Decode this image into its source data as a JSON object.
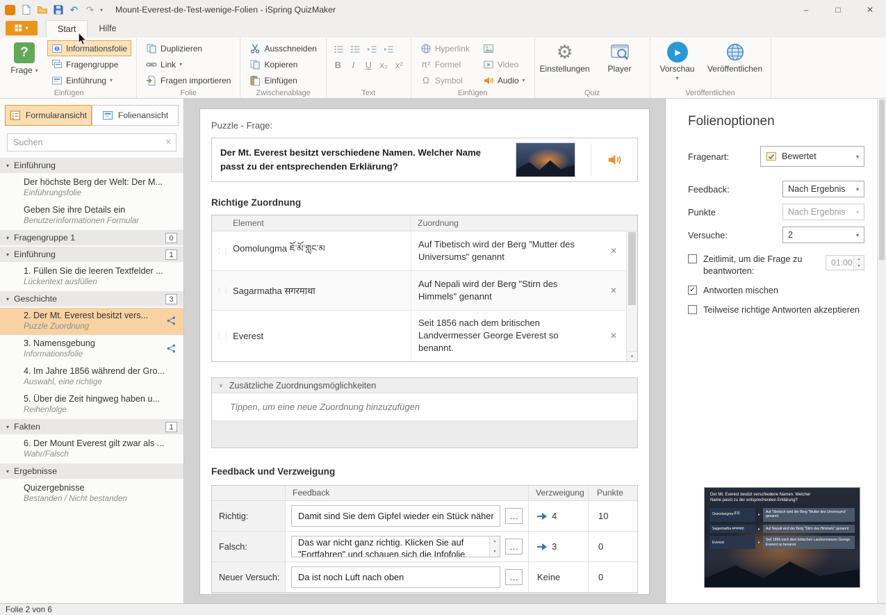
{
  "titlebar": {
    "title": "Mount-Everest-de-Test-wenige-Folien - iSpring QuizMaker"
  },
  "tabs": {
    "start": "Start",
    "hilfe": "Hilfe"
  },
  "icons": {
    "caret": "▾",
    "chevron_down": "▾",
    "vee": "∨",
    "close": "✕",
    "clear": "✕",
    "minimize": "–",
    "maximize": "□",
    "undo": "↶",
    "redo": "↷",
    "gear": "⚙",
    "play": "▶",
    "more": "…",
    "drag": "⋮⋮",
    "check": "✓",
    "spin_up": "▲",
    "spin_down": "▼",
    "question": "?",
    "formula": "π²",
    "omega": "Ω",
    "tri_right": "▸"
  },
  "ribbon": {
    "frage": {
      "label": "Frage"
    },
    "insert_group": {
      "label": "Einfügen",
      "informationsfolie": "Informationsfolie",
      "fragengruppe": "Fragengruppe",
      "einfuehrung": "Einführung"
    },
    "folie_group": {
      "label": "Folie",
      "duplizieren": "Duplizieren",
      "link": "Link",
      "fragen_importieren": "Fragen importieren"
    },
    "clipboard_group": {
      "label": "Zwischenablage",
      "ausschneiden": "Ausschneiden",
      "kopieren": "Kopieren",
      "einfuegen": "Einfügen"
    },
    "text_group": {
      "label": "Text",
      "bold": "B",
      "italic": "I",
      "underline": "U",
      "subscript": "x₂",
      "superscript": "x²"
    },
    "insert2_group": {
      "label": "Einfügen",
      "hyperlink": "Hyperlink",
      "formel": "Formel",
      "symbol": "Symbol",
      "bild": "Bild",
      "video": "Video",
      "audio": "Audio"
    },
    "quiz_group": {
      "label": "Quiz",
      "einstellungen": "Einstellungen",
      "player": "Player"
    },
    "publish_group": {
      "label": "Veröffentlichen",
      "vorschau": "Vorschau",
      "veroeffentlichen": "Veröffentlichen"
    }
  },
  "sidebar": {
    "tabs": {
      "form": "Formularansicht",
      "slide": "Folienansicht"
    },
    "search_placeholder": "Suchen",
    "tree": [
      {
        "is_section": true,
        "label": "Einführung"
      },
      {
        "is_slide": true,
        "title": "Der höchste Berg der Welt: Der M...",
        "subtitle": "Einführungsfolie"
      },
      {
        "is_slide": true,
        "title": "Geben Sie ihre Details ein",
        "subtitle": "Benutzerinformationen Formular"
      },
      {
        "is_section": true,
        "label": "Fragengruppe 1",
        "badge": "0"
      },
      {
        "is_section": true,
        "label": "Einführung",
        "badge": "1"
      },
      {
        "is_slide": true,
        "title": "1. Füllen Sie die leeren Textfelder ...",
        "subtitle": "Lückentext ausfüllen"
      },
      {
        "is_section": true,
        "label": "Geschichte",
        "badge": "3"
      },
      {
        "is_slide": true,
        "title": "2. Der Mt. Everest besitzt vers...",
        "subtitle": "Puzzle Zuordnung",
        "selected": true,
        "branch": true
      },
      {
        "is_slide": true,
        "title": "3. Namensgebung",
        "subtitle": "Informationsfolie",
        "branch": true
      },
      {
        "is_slide": true,
        "title": "4. Im Jahre 1856 während der Gro...",
        "subtitle": "Auswahl, eine richtige"
      },
      {
        "is_slide": true,
        "title": "5. Über die Zeit hingweg haben u...",
        "subtitle": "Reihenfolge"
      },
      {
        "is_section": true,
        "label": "Fakten",
        "badge": "1"
      },
      {
        "is_slide": true,
        "title": "6. Der Mount Everest gilt zwar als ...",
        "subtitle": "Wahr/Falsch"
      },
      {
        "is_section": true,
        "label": "Ergebnisse"
      },
      {
        "is_slide": true,
        "title": "Quizergebnisse",
        "subtitle": "Bestanden / Nicht bestanden"
      }
    ]
  },
  "main": {
    "question_label": "Puzzle - Frage:",
    "question_text": "Der Mt. Everest besitzt verschiedene Namen. Welcher Name passt zu der entsprechenden Erklärung?",
    "matching": {
      "heading": "Richtige Zuordnung",
      "col_element": "Element",
      "col_zuordnung": "Zuordnung",
      "rows": [
        {
          "element": "Oomolungma ཇོ་མོ་གླང་མ",
          "match": "Auf Tibetisch wird der Berg \"Mutter des Universums\" genannt"
        },
        {
          "element": "Sagarmatha सगरमाथा",
          "match": "Auf Nepali wird der Berg \"Stirn des Himmels\" genannt"
        },
        {
          "element": "Everest",
          "match": "Seit 1856 nach dem britischen Landvermesser George Everest so benannt."
        }
      ]
    },
    "extra": {
      "heading": "Zusätzliche Zuordnungsmöglichkeiten",
      "hint": "Tippen, um eine neue Zuordnung hinzuzufügen"
    },
    "feedback": {
      "heading": "Feedback und Verzweigung",
      "col_feedback": "Feedback",
      "col_verzweigung": "Verzweigung",
      "col_punkte": "Punkte",
      "rows": [
        {
          "label": "Richtig:",
          "text": "Damit sind Sie dem Gipfel wieder ein Stück näher",
          "branch": "4",
          "points": "10",
          "has_arrow": true
        },
        {
          "label": "Falsch:",
          "text": "Das war nicht  ganz richtig. Klicken Sie auf \"Fortfahren\" und schauen sich die Infofolie genau",
          "branch": "3",
          "points": "0",
          "has_arrow": true,
          "spinner": true,
          "multiline": true
        },
        {
          "label": "Neuer Versuch:",
          "text": "Da ist noch Luft nach oben",
          "branch": "Keine",
          "points": "0"
        }
      ]
    }
  },
  "options": {
    "title": "Folienoptionen",
    "fragenart": {
      "label": "Fragenart:",
      "value": "Bewertet"
    },
    "feedback": {
      "label": "Feedback:",
      "value": "Nach Ergebnis"
    },
    "punkte": {
      "label": "Punkte",
      "value": "Nach Ergebnis"
    },
    "versuche": {
      "label": "Versuche:",
      "value": "2"
    },
    "zeitlimit": {
      "label": "Zeitlimit, um die Frage zu beantworten:",
      "value": "01:00"
    },
    "mischen": "Antworten mischen",
    "teilweise": "Teilweise richtige Antworten akzeptieren",
    "thumbnail": {
      "title": "Der Mt. Everest besitzt verschiedene Namen. Welcher Name passt zu der entsprechenden Erklärung?",
      "pairs": [
        {
          "left": "Oomolungma ཇོ་མོ་",
          "right": "Auf Tibetisch wird der Berg \"Mutter des Universums\" genannt"
        },
        {
          "left": "Sagarmatha सगरमाथा",
          "right": "Auf Nepali wird der Berg \"Stirn des Himmels\" genannt"
        },
        {
          "left": "Everest",
          "right": "Seit 1856 nach dem britischen Landvermesser George Everest so benannt"
        }
      ]
    }
  },
  "statusbar": {
    "text": "Folie 2 von 6"
  }
}
